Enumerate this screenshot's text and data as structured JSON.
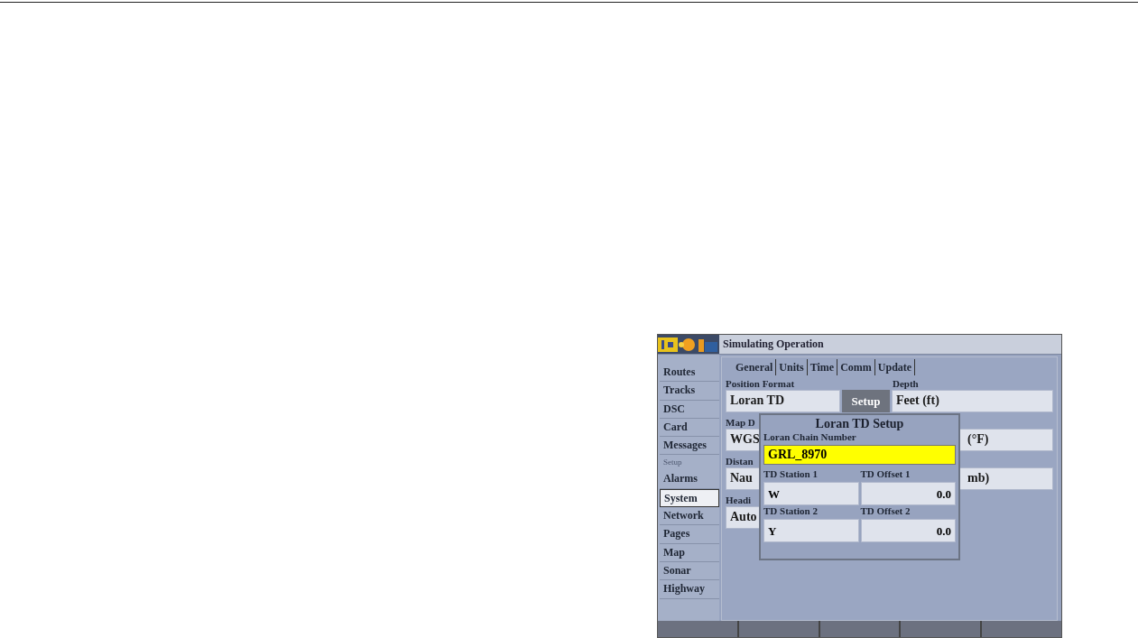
{
  "title_bar": {
    "title": "Simulating Operation"
  },
  "sidebar": {
    "items": [
      {
        "label": "Routes",
        "kind": "item",
        "selected": false
      },
      {
        "label": "Tracks",
        "kind": "item",
        "selected": false
      },
      {
        "label": "DSC",
        "kind": "item",
        "selected": false
      },
      {
        "label": "Card",
        "kind": "item",
        "selected": false
      },
      {
        "label": "Messages",
        "kind": "item",
        "selected": false
      },
      {
        "label": "Setup",
        "kind": "header"
      },
      {
        "label": "Alarms",
        "kind": "item",
        "selected": false
      },
      {
        "label": "System",
        "kind": "item",
        "selected": true
      },
      {
        "label": "Network",
        "kind": "item",
        "selected": false
      },
      {
        "label": "Pages",
        "kind": "item",
        "selected": false
      },
      {
        "label": "Map",
        "kind": "item",
        "selected": false
      },
      {
        "label": "Sonar",
        "kind": "item",
        "selected": false
      },
      {
        "label": "Highway",
        "kind": "item",
        "selected": false
      }
    ]
  },
  "tabs": [
    {
      "label": "General"
    },
    {
      "label": "Units"
    },
    {
      "label": "Time"
    },
    {
      "label": "Comm"
    },
    {
      "label": "Update"
    }
  ],
  "form": {
    "rows": [
      {
        "left_label": "Position Format",
        "left_value": "Loran TD",
        "button": "Setup",
        "right_label": "Depth",
        "right_value": "Feet (ft)",
        "right_covered": false
      },
      {
        "left_label": "Map D",
        "left_value": "WGS",
        "right_value": "(°F)",
        "right_covered": true
      },
      {
        "left_label": "Distan",
        "left_value": "Nau",
        "right_value": "mb)",
        "right_covered": true
      },
      {
        "left_label": "Headi",
        "left_value": "Auto"
      }
    ]
  },
  "popup": {
    "title": "Loran TD Setup",
    "chain_label": "Loran Chain Number",
    "chain_value": "GRL_8970",
    "stations": [
      {
        "station_label": "TD Station 1",
        "station_value": "W",
        "offset_label": "TD Offset 1",
        "offset_value": "0.0"
      },
      {
        "station_label": "TD Station 2",
        "station_value": "Y",
        "offset_label": "TD Offset 2",
        "offset_value": "0.0"
      }
    ]
  },
  "soft_keys": [
    {
      "kind": "blank"
    },
    {
      "kind": "blank"
    },
    {
      "kind": "blank"
    },
    {
      "kind": "blank"
    },
    {
      "kind": "blank"
    }
  ]
}
